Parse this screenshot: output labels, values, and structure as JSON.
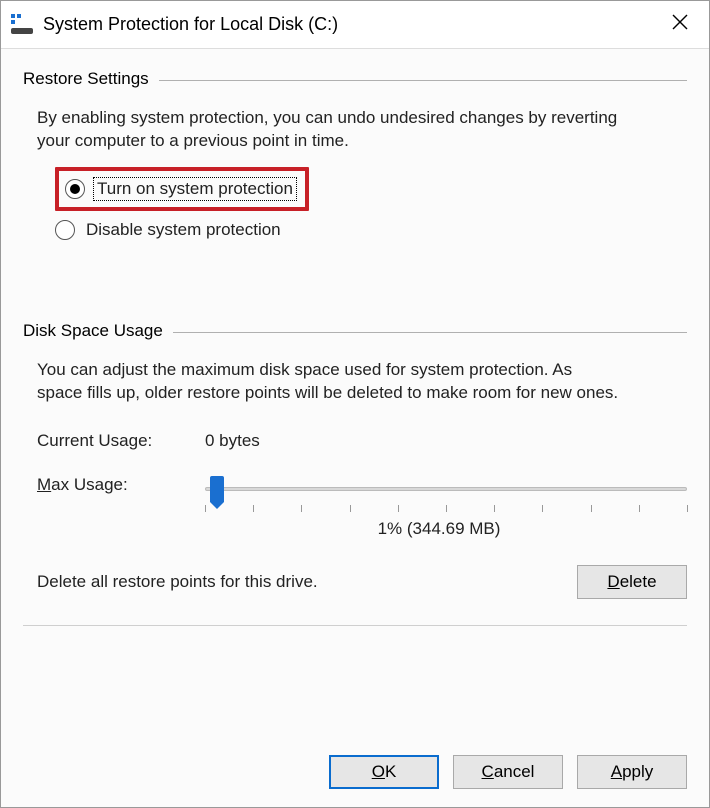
{
  "window": {
    "title": "System Protection for Local Disk (C:)"
  },
  "restore": {
    "group_label": "Restore Settings",
    "description": "By enabling system protection, you can undo undesired changes by reverting your computer to a previous point in time.",
    "option_on": "Turn on system protection",
    "option_off": "Disable system protection",
    "selected": "on"
  },
  "disk": {
    "group_label": "Disk Space Usage",
    "description": "You can adjust the maximum disk space used for system protection. As space fills up, older restore points will be deleted to make room for new ones.",
    "current_label": "Current Usage:",
    "current_value": "0 bytes",
    "max_label": "Max Usage:",
    "slider_percent": 1,
    "slider_value_text": "1% (344.69 MB)",
    "delete_text": "Delete all restore points for this drive.",
    "delete_button": "Delete"
  },
  "footer": {
    "ok": "OK",
    "cancel": "Cancel",
    "apply": "Apply"
  }
}
